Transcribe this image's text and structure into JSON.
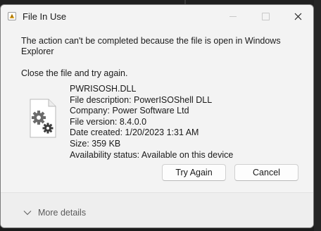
{
  "window": {
    "title": "File In Use"
  },
  "dialog": {
    "message": "The action can't be completed because the file is open in Windows Explorer",
    "instruction": "Close the file and try again."
  },
  "file": {
    "icon": "dll-settings-file-icon",
    "name": "PWRISOSH.DLL",
    "description": "File description: PowerISOShell DLL",
    "company": "Company: Power Software Ltd",
    "version": "File version: 8.4.0.0",
    "date_created": "Date created: 1/20/2023 1:31 AM",
    "size": "Size: 359 KB",
    "availability": "Availability status: Available on this device"
  },
  "buttons": {
    "try_again": "Try Again",
    "cancel": "Cancel"
  },
  "footer": {
    "more_details": "More details"
  }
}
